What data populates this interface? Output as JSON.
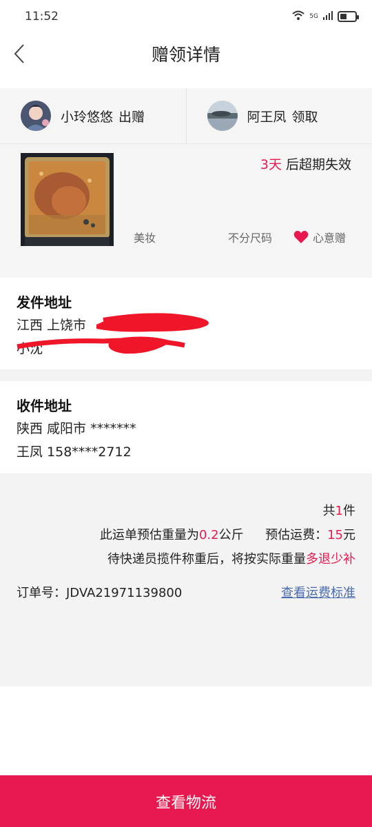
{
  "status_bar": {
    "time": "11:52",
    "signal_label": "5G",
    "wifi_label": "6"
  },
  "header": {
    "title": "赠领详情"
  },
  "giver": {
    "name": "小玲悠悠",
    "action": "出赠"
  },
  "receiver": {
    "name": "阿王凤",
    "action": "领取"
  },
  "product": {
    "expire_days": "3天",
    "expire_suffix": " 后超期失效",
    "category": "美妆",
    "size": "不分尺码",
    "gift_label": "心意赠"
  },
  "sender_address": {
    "title": "发件地址",
    "line1": "江西 上饶市",
    "line2": "小沈"
  },
  "receiver_address": {
    "title": "收件地址",
    "line1": "陕西 咸阳市 *******",
    "line2": "王凤 158****2712"
  },
  "shipping": {
    "count_prefix": "共",
    "count": "1",
    "count_suffix": "件",
    "weight_prefix": "此运单预估重量为",
    "weight": "0.2",
    "weight_unit": "公斤",
    "fee_prefix": "预估运费：",
    "fee": "15",
    "fee_unit": "元",
    "notice_prefix": "待快递员揽件称重后，将按实际重量",
    "notice_highlight": "多退少补",
    "order_label": "订单号：",
    "order_number": "JDVA21971139800",
    "fee_standard_link": "查看运费标准"
  },
  "bottom_button": {
    "label": "查看物流"
  },
  "colors": {
    "accent": "#e8194e",
    "link": "#4a6bb0"
  }
}
